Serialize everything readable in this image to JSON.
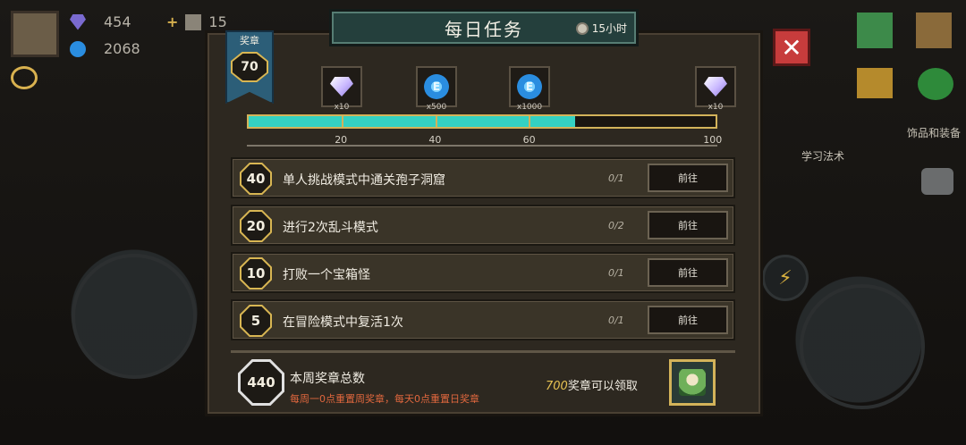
{
  "hud": {
    "gem_count": "454",
    "coin_count": "2068",
    "material_count": "15",
    "accessory_label": "饰品和装备",
    "learn_label": "学习法术"
  },
  "panel": {
    "title": "每日任务",
    "timer": "15小时",
    "ribbon_label": "奖章",
    "current_medals": "70"
  },
  "rewards": [
    {
      "icon": "diamond-icon",
      "qty": "x10"
    },
    {
      "icon": "blue-coin-icon",
      "qty": "x500"
    },
    {
      "icon": "blue-coin-icon",
      "qty": "x1000"
    },
    {
      "icon": "diamond-icon",
      "qty": "x10"
    }
  ],
  "progress": {
    "value": 70,
    "max": 100,
    "milestones": [
      "20",
      "40",
      "60",
      "100"
    ]
  },
  "tasks": [
    {
      "points": "40",
      "name": "单人挑战模式中通关孢子洞窟",
      "progress": "0/1",
      "button": "前往"
    },
    {
      "points": "20",
      "name": "进行2次乱斗模式",
      "progress": "0/2",
      "button": "前往"
    },
    {
      "points": "10",
      "name": "打败一个宝箱怪",
      "progress": "0/1",
      "button": "前往"
    },
    {
      "points": "5",
      "name": "在冒险模式中复活1次",
      "progress": "0/1",
      "button": "前往"
    }
  ],
  "weekly": {
    "total": "440",
    "title": "本周奖章总数",
    "note": "每周一0点重置周奖章，每天0点重置日奖章",
    "claim_amount": "700",
    "claim_text": "奖章可以领取"
  },
  "colors": {
    "accent_teal": "#34d1c2",
    "gold": "#d3b35a",
    "note_red": "#e0673e"
  }
}
